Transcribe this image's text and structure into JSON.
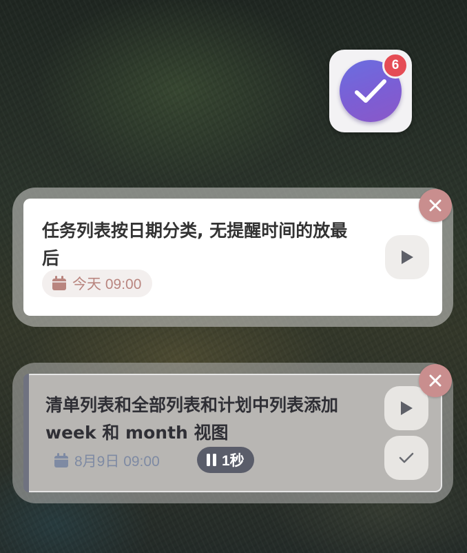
{
  "app": {
    "badge_count": "6",
    "icon": "checkmark-icon",
    "accent": "#6a6ee0",
    "badge_color": "#e54c55"
  },
  "tasks": [
    {
      "title": "任务列表按日期分类, 无提醒时间的放最后",
      "date": "今天 09:00",
      "date_color": "#b9857f"
    },
    {
      "title": "清单列表和全部列表和计划中列表添加 week 和 month 视图",
      "date": "8月9日 09:00",
      "timer": "1秒",
      "date_color": "#7e8aa3"
    }
  ],
  "icons": {
    "close": "close-icon",
    "play": "play-icon",
    "check": "check-icon",
    "calendar": "calendar-icon",
    "pause": "pause-icon"
  }
}
